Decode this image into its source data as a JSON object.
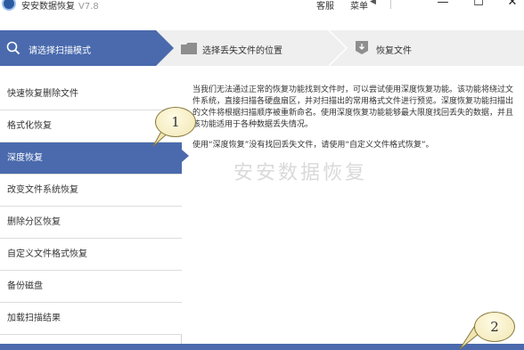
{
  "titlebar": {
    "title": "安安数据恢复",
    "version": "V7.8",
    "service_label": "客服",
    "menu_label": "菜单",
    "menu_caret": "◀",
    "minimize": "—",
    "maximize": "☐",
    "close": "✕"
  },
  "steps": [
    {
      "label": "请选择扫描模式",
      "icon": "search-icon",
      "active": true
    },
    {
      "label": "选择丢失文件的位置",
      "icon": "folder-icon",
      "active": false
    },
    {
      "label": "恢复文件",
      "icon": "download-icon",
      "active": false
    }
  ],
  "sidebar": {
    "items": [
      {
        "label": "快速恢复删除文件",
        "active": false
      },
      {
        "label": "格式化恢复",
        "active": false
      },
      {
        "label": "深度恢复",
        "active": true
      },
      {
        "label": "改变文件系统恢复",
        "active": false
      },
      {
        "label": "删除分区恢复",
        "active": false
      },
      {
        "label": "自定义文件格式恢复",
        "active": false
      },
      {
        "label": "备份磁盘",
        "active": false
      },
      {
        "label": "加载扫描结果",
        "active": false
      }
    ]
  },
  "description": {
    "paragraph1": "当我们无法通过正常的恢复功能找到文件时，可以尝试使用深度恢复功能。该功能将绕过文件系统，直接扫描各硬盘扇区，并对扫描出的常用格式文件进行预览。深度恢复功能扫描出的文件将根据扫描顺序被重新命名。使用深度恢复功能能够最大限度找回丢失的数据，并且该功能适用于各种数据丢失情况。",
    "paragraph2": "使用“深度恢复”没有找回丢失文件，请使用“自定义文件格式恢复”。"
  },
  "watermark": "安安数据恢复",
  "callouts": {
    "one": "1",
    "two": "2"
  },
  "colors": {
    "accent": "#4a6aad",
    "step_inactive_bg": "#efefef",
    "callout_fill": "#f1e6b2"
  }
}
